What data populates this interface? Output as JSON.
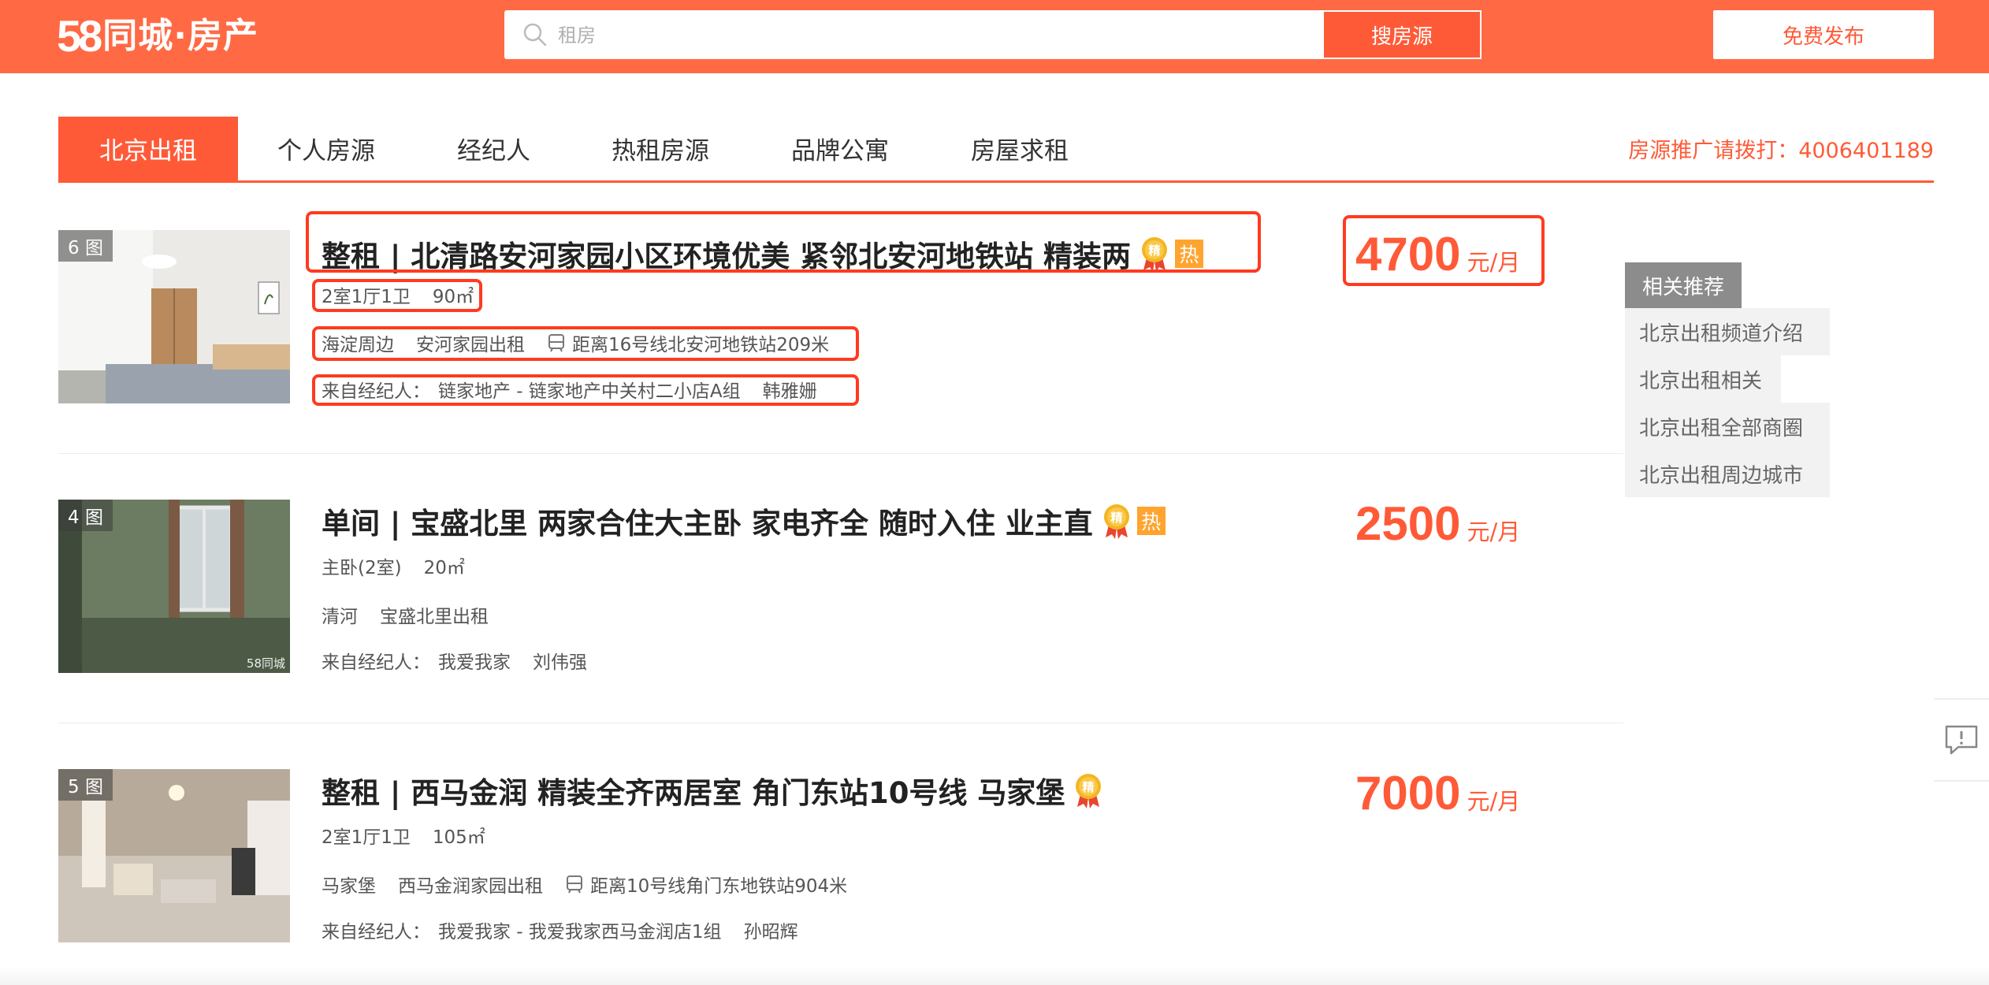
{
  "header": {
    "logo_num": "58",
    "logo_text": "同城·房产",
    "search_placeholder": "租房",
    "search_button": "搜房源",
    "publish_button": "免费发布"
  },
  "tabs": [
    {
      "label": "北京出租",
      "active": true
    },
    {
      "label": "个人房源"
    },
    {
      "label": "经纪人"
    },
    {
      "label": "热租房源"
    },
    {
      "label": "品牌公寓"
    },
    {
      "label": "房屋求租"
    }
  ],
  "hotline": "房源推广请拨打：4006401189",
  "listings": [
    {
      "pic_count": "6 图",
      "title": "整租 | 北清路安河家园小区环境优美 紧邻北安河地铁站 精装两",
      "jing": "精",
      "re": "热",
      "room": "2室1厅1卫",
      "area": "90㎡",
      "district": "海淀周边",
      "community": "安河家园出租",
      "metro": "距离16号线北安河地铁站209米",
      "agent_prefix": "来自经纪人：",
      "agent_company": "链家地产 - 链家地产中关村二小店A组",
      "agent_name": "韩雅姗",
      "price": "4700",
      "unit": "元/月"
    },
    {
      "pic_count": "4 图",
      "watermark": "58同城",
      "title": "单间 | 宝盛北里 两家合住大主卧 家电齐全 随时入住 业主直",
      "jing": "精",
      "re": "热",
      "room": "主卧(2室)",
      "area": "20㎡",
      "district": "清河",
      "community": "宝盛北里出租",
      "agent_prefix": "来自经纪人：",
      "agent_company": "我爱我家",
      "agent_name": "刘伟强",
      "price": "2500",
      "unit": "元/月"
    },
    {
      "pic_count": "5 图",
      "title": "整租 | 西马金润 精装全齐两居室 角门东站10号线 马家堡",
      "jing": "精",
      "room": "2室1厅1卫",
      "area": "105㎡",
      "district": "马家堡",
      "community": "西马金润家园出租",
      "metro": "距离10号线角门东地铁站904米",
      "agent_prefix": "来自经纪人：",
      "agent_company": "我爱我家 - 我爱我家西马金润店1组",
      "agent_name": "孙昭辉",
      "price": "7000",
      "unit": "元/月"
    }
  ],
  "sidebar": {
    "title": "相关推荐",
    "items": [
      "北京出租频道介绍",
      "北京出租相关",
      "北京出租全部商圈",
      "北京出租周边城市"
    ]
  },
  "colors": {
    "brand": "#ff6a45",
    "accent": "#ff5a37",
    "highlight": "#ff3b1f",
    "hot_badge": "#ffa42e"
  }
}
